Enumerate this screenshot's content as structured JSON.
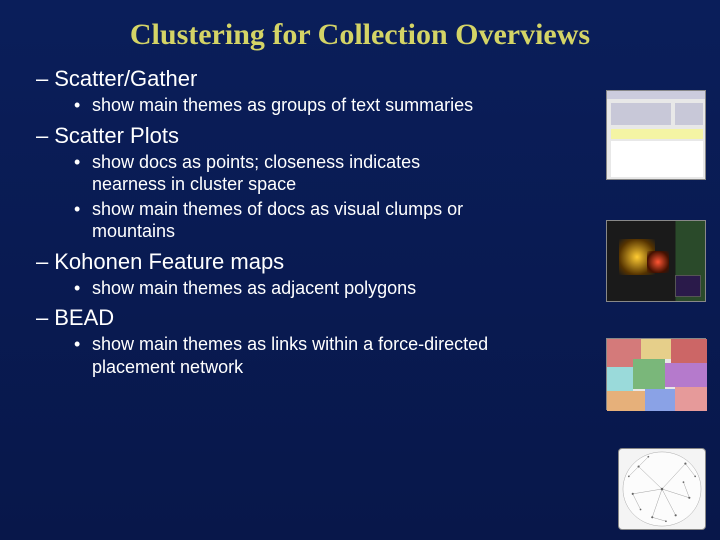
{
  "title": "Clustering  for Collection Overviews",
  "sections": [
    {
      "heading": "Scatter/Gather",
      "bullets": [
        "show main themes as groups of text summaries"
      ]
    },
    {
      "heading": "Scatter Plots",
      "bullets": [
        "show docs as points; closeness indicates nearness in cluster space",
        "show main themes of docs as visual clumps or mountains"
      ]
    },
    {
      "heading": "Kohonen Feature maps",
      "bullets": [
        "show main themes as adjacent polygons"
      ]
    },
    {
      "heading": "BEAD",
      "bullets": [
        "show main themes as links within a force-directed placement network"
      ]
    }
  ],
  "thumbs": [
    {
      "name": "scatter-gather-thumbnail"
    },
    {
      "name": "scatter-plot-thumbnail"
    },
    {
      "name": "kohonen-map-thumbnail"
    },
    {
      "name": "bead-network-thumbnail"
    }
  ]
}
